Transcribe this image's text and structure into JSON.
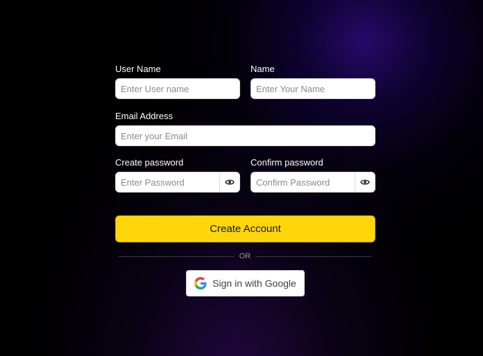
{
  "form": {
    "username": {
      "label": "User Name",
      "placeholder": "Enter User name",
      "value": ""
    },
    "name": {
      "label": "Name",
      "placeholder": "Enter Your Name",
      "value": ""
    },
    "email": {
      "label": "Email Address",
      "placeholder": "Enter your Email",
      "value": ""
    },
    "password": {
      "label": "Create password",
      "placeholder": "Enter Password",
      "value": "",
      "toggle_icon": "eye-icon"
    },
    "confirm_password": {
      "label": "Confirm password",
      "placeholder": "Confirm Password",
      "value": "",
      "toggle_icon": "eye-icon"
    },
    "submit_label": "Create Account",
    "separator_text": "OR",
    "google_label": "Sign in with Google",
    "google_icon": "google-logo-icon"
  },
  "colors": {
    "background": "#000000",
    "glow": "#1a0560",
    "primary": "#ffd60a",
    "label_text": "#ffffff"
  }
}
